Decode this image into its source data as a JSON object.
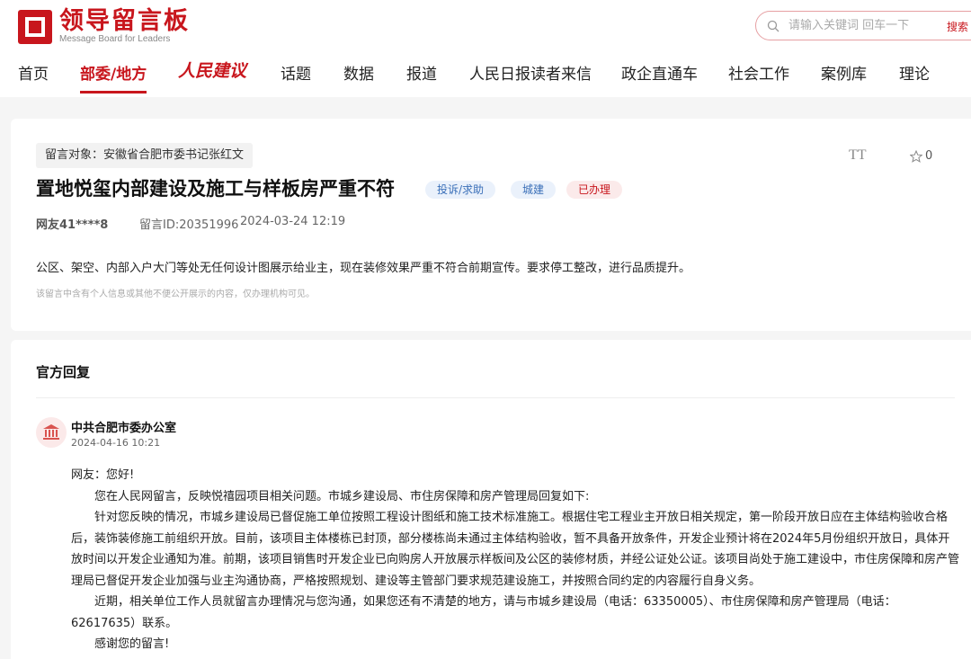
{
  "header": {
    "logo_title": "领导留言板",
    "logo_subtitle": "Message Board for Leaders",
    "search_placeholder": "请输入关键词 回车一下",
    "search_button": "搜索"
  },
  "nav": {
    "items": [
      {
        "label": "首页"
      },
      {
        "label": "部委/地方"
      },
      {
        "label": "人民建议"
      },
      {
        "label": "话题"
      },
      {
        "label": "数据"
      },
      {
        "label": "报道"
      },
      {
        "label": "人民日报读者来信"
      },
      {
        "label": "政企直通车"
      },
      {
        "label": "社会工作"
      },
      {
        "label": "案例库"
      },
      {
        "label": "理论"
      }
    ],
    "active": "部委/地方"
  },
  "message": {
    "target": "留言对象：安徽省合肥市委书记张红文",
    "title": "置地悦玺内部建设及施工与样板房严重不符",
    "tags": [
      "投诉/求助",
      "城建",
      "已办理"
    ],
    "author": "网友41****8",
    "id_text": "留言ID:20351996",
    "time": "2024-03-24 12:19",
    "font_toggle": "TT",
    "fav_count": "0",
    "body": "公区、架空、内部入户大门等处无任何设计图展示给业主，现在装修效果严重不符合前期宣传。要求停工整改，进行品质提升。",
    "note": "该留言中含有个人信息或其他不便公开展示的内容，仅办理机构可见。"
  },
  "reply": {
    "heading": "官方回复",
    "org_name": "中共合肥市委办公室",
    "org_time": "2024-04-16 10:21",
    "paragraphs": [
      "网友：您好!",
      "您在人民网留言，反映悦禧园项目相关问题。市城乡建设局、市住房保障和房产管理局回复如下:",
      "针对您反映的情况，市城乡建设局已督促施工单位按照工程设计图纸和施工技术标准施工。根据住宅工程业主开放日相关规定，第一阶段开放日应在主体结构验收合格后，装饰装修施工前组织开放。目前，该项目主体楼栋已封顶，部分楼栋尚未通过主体结构验收，暂不具备开放条件，开发企业预计将在2024年5月份组织开放日，具体开放时间以开发企业通知为准。前期，该项目销售时开发企业已向购房人开放展示样板间及公区的装修材质，并经公证处公证。该项目尚处于施工建设中，市住房保障和房产管理局已督促开发企业加强与业主沟通协商，严格按照规划、建设等主管部门要求规范建设施工，并按照合同约定的内容履行自身义务。",
      "近期，相关单位工作人员就留言办理情况与您沟通，如果您还有不清楚的地方，请与市城乡建设局（电话：63350005）、市住房保障和房产管理局（电话：62617635）联系。",
      "感谢您的留言!"
    ]
  }
}
